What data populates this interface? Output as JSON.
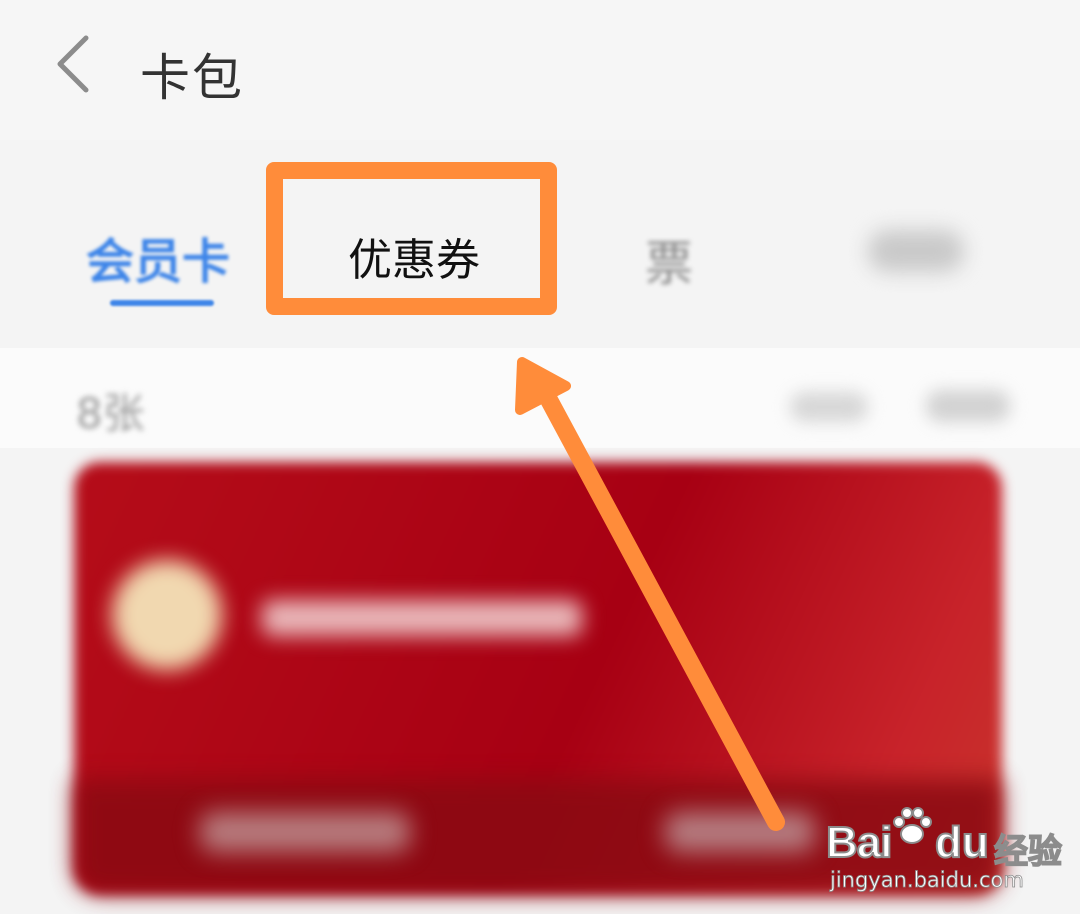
{
  "header": {
    "title": "卡包"
  },
  "tabs": [
    {
      "label": "会员卡",
      "active": true
    },
    {
      "label": "优惠券",
      "active": false
    },
    {
      "label": "票",
      "active": false
    }
  ],
  "list": {
    "count": "8张"
  },
  "colors": {
    "accent": "#3e85e8",
    "highlight": "#ff8c3a",
    "card": "#a70013"
  },
  "watermark": {
    "brand_left": "Bai",
    "brand_right": "du",
    "brand_cn": "经验",
    "url": "jingyan.baidu.com"
  }
}
